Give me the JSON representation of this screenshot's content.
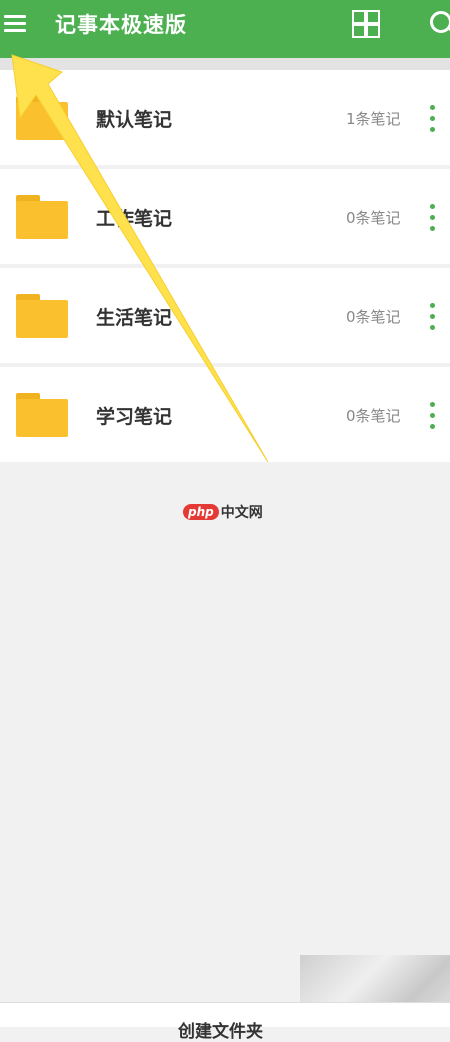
{
  "app": {
    "title": "记事本极速版"
  },
  "toolbar": {
    "menu_icon": "hamburger-menu-icon",
    "grid_icon": "grid-view-icon",
    "search_icon": "search-icon"
  },
  "folders": [
    {
      "name": "默认笔记",
      "count": "1条笔记"
    },
    {
      "name": "工作笔记",
      "count": "0条笔记"
    },
    {
      "name": "生活笔记",
      "count": "0条笔记"
    },
    {
      "name": "学习笔记",
      "count": "0条笔记"
    }
  ],
  "watermark": {
    "badge": "php",
    "text": "中文网"
  },
  "bottom": {
    "create_folder_label": "创建文件夹"
  },
  "colors": {
    "accent": "#4caf50",
    "folder": "#fbc02d",
    "arrow": "#ffe14d"
  }
}
